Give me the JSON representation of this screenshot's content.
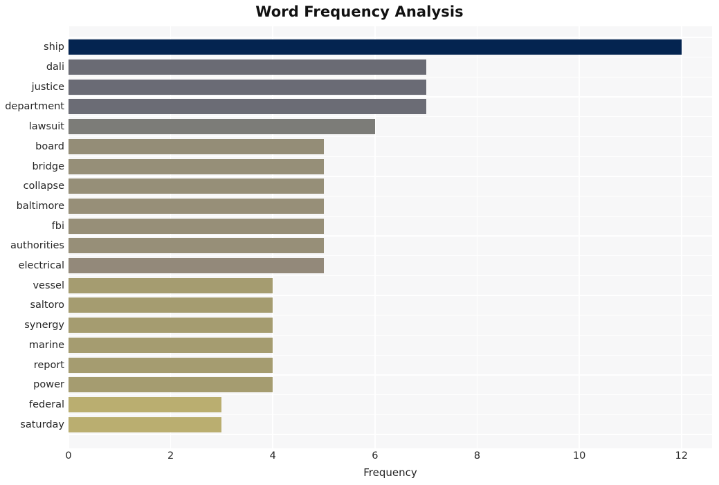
{
  "chart_data": {
    "type": "bar",
    "orientation": "horizontal",
    "title": "Word Frequency Analysis",
    "xlabel": "Frequency",
    "ylabel": "",
    "xlim": [
      0,
      12.6
    ],
    "ylim": [
      0,
      20
    ],
    "grid": true,
    "legend": null,
    "xticks": [
      "0",
      "2",
      "4",
      "6",
      "8",
      "10",
      "12"
    ],
    "xtick_values": [
      0,
      2,
      4,
      6,
      8,
      10,
      12
    ],
    "categories": [
      "ship",
      "dali",
      "justice",
      "department",
      "lawsuit",
      "board",
      "bridge",
      "collapse",
      "baltimore",
      "fbi",
      "authorities",
      "electrical",
      "vessel",
      "saltoro",
      "synergy",
      "marine",
      "report",
      "power",
      "federal",
      "saturday"
    ],
    "values": [
      12,
      7,
      7,
      7,
      6,
      5,
      5,
      5,
      5,
      5,
      5,
      5,
      4,
      4,
      4,
      4,
      4,
      4,
      3,
      3
    ],
    "bar_colors": [
      "#042450",
      "#6a6b74",
      "#6a6b75",
      "#6b6c75",
      "#7c7c78",
      "#948d77",
      "#968f78",
      "#968f78",
      "#978f78",
      "#978f78",
      "#978f78",
      "#93897a",
      "#a59c70",
      "#a59c70",
      "#a59c70",
      "#a59c70",
      "#a59c70",
      "#a59c70",
      "#baae70",
      "#baae70"
    ],
    "plot_background": "#f7f7f8",
    "grid_color": "#ffffff",
    "figure_background": "#ffffff"
  }
}
